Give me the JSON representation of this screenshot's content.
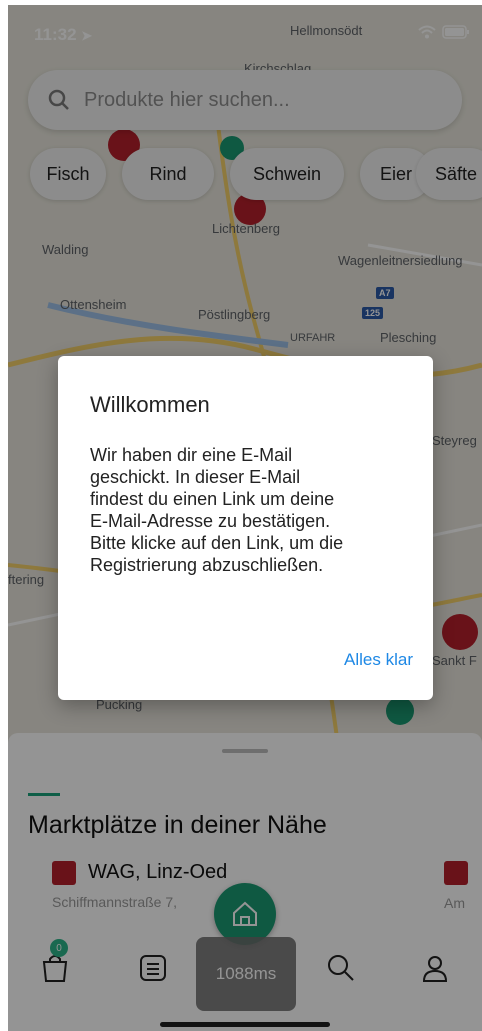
{
  "status_bar": {
    "time": "11:32"
  },
  "search": {
    "placeholder": "Produkte hier suchen..."
  },
  "chips": [
    "Fisch",
    "Rind",
    "Schwein",
    "Eier",
    "Säfte"
  ],
  "map": {
    "labels": [
      "Hellmonsödt",
      "Kirchschlag",
      "Lichtenberg",
      "Walding",
      "Wagenleitnersiedlung",
      "Ottensheim",
      "Pöstlingberg",
      "URFAHR",
      "Plesching",
      "Steyreg",
      "Sankt F",
      "Pucking",
      "ftering"
    ],
    "road_badges": [
      "A7",
      "125"
    ]
  },
  "dialog": {
    "title": "Willkommen",
    "body_lines": [
      "Wir haben dir eine E-Mail",
      "geschickt. In dieser E-Mail",
      "findest du einen Link um deine",
      "E-Mail-Adresse zu bestätigen.",
      "Bitte klicke auf den Link, um die",
      "Registrierung abzuschließen."
    ],
    "confirm_label": "Alles klar"
  },
  "sheet": {
    "title": "Marktplätze in deiner Nähe",
    "markets": [
      {
        "name": "WAG, Linz-Oed",
        "address": "Schiffmannstraße 7,"
      },
      {
        "name": "",
        "address": "Am"
      }
    ]
  },
  "tabbar": {
    "cart_badge": "0",
    "perf_label": "1088ms"
  },
  "colors": {
    "accent": "#1a9a73",
    "brand_red": "#b5202b",
    "link_blue": "#1e88e5"
  }
}
